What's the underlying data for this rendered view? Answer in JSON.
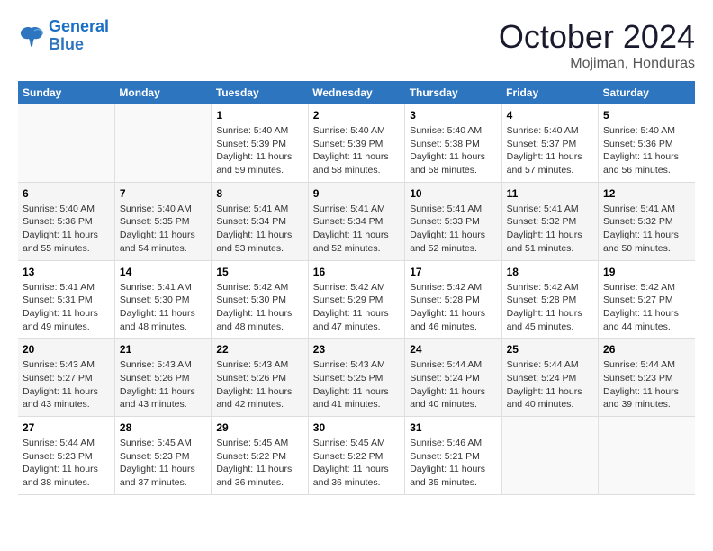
{
  "logo": {
    "line1": "General",
    "line2": "Blue"
  },
  "title": "October 2024",
  "location": "Mojiman, Honduras",
  "weekdays": [
    "Sunday",
    "Monday",
    "Tuesday",
    "Wednesday",
    "Thursday",
    "Friday",
    "Saturday"
  ],
  "weeks": [
    [
      null,
      null,
      {
        "day": "1",
        "sunrise": "5:40 AM",
        "sunset": "5:39 PM",
        "daylight": "11 hours and 59 minutes."
      },
      {
        "day": "2",
        "sunrise": "5:40 AM",
        "sunset": "5:39 PM",
        "daylight": "11 hours and 58 minutes."
      },
      {
        "day": "3",
        "sunrise": "5:40 AM",
        "sunset": "5:38 PM",
        "daylight": "11 hours and 58 minutes."
      },
      {
        "day": "4",
        "sunrise": "5:40 AM",
        "sunset": "5:37 PM",
        "daylight": "11 hours and 57 minutes."
      },
      {
        "day": "5",
        "sunrise": "5:40 AM",
        "sunset": "5:36 PM",
        "daylight": "11 hours and 56 minutes."
      }
    ],
    [
      {
        "day": "6",
        "sunrise": "5:40 AM",
        "sunset": "5:36 PM",
        "daylight": "11 hours and 55 minutes."
      },
      {
        "day": "7",
        "sunrise": "5:40 AM",
        "sunset": "5:35 PM",
        "daylight": "11 hours and 54 minutes."
      },
      {
        "day": "8",
        "sunrise": "5:41 AM",
        "sunset": "5:34 PM",
        "daylight": "11 hours and 53 minutes."
      },
      {
        "day": "9",
        "sunrise": "5:41 AM",
        "sunset": "5:34 PM",
        "daylight": "11 hours and 52 minutes."
      },
      {
        "day": "10",
        "sunrise": "5:41 AM",
        "sunset": "5:33 PM",
        "daylight": "11 hours and 52 minutes."
      },
      {
        "day": "11",
        "sunrise": "5:41 AM",
        "sunset": "5:32 PM",
        "daylight": "11 hours and 51 minutes."
      },
      {
        "day": "12",
        "sunrise": "5:41 AM",
        "sunset": "5:32 PM",
        "daylight": "11 hours and 50 minutes."
      }
    ],
    [
      {
        "day": "13",
        "sunrise": "5:41 AM",
        "sunset": "5:31 PM",
        "daylight": "11 hours and 49 minutes."
      },
      {
        "day": "14",
        "sunrise": "5:41 AM",
        "sunset": "5:30 PM",
        "daylight": "11 hours and 48 minutes."
      },
      {
        "day": "15",
        "sunrise": "5:42 AM",
        "sunset": "5:30 PM",
        "daylight": "11 hours and 48 minutes."
      },
      {
        "day": "16",
        "sunrise": "5:42 AM",
        "sunset": "5:29 PM",
        "daylight": "11 hours and 47 minutes."
      },
      {
        "day": "17",
        "sunrise": "5:42 AM",
        "sunset": "5:28 PM",
        "daylight": "11 hours and 46 minutes."
      },
      {
        "day": "18",
        "sunrise": "5:42 AM",
        "sunset": "5:28 PM",
        "daylight": "11 hours and 45 minutes."
      },
      {
        "day": "19",
        "sunrise": "5:42 AM",
        "sunset": "5:27 PM",
        "daylight": "11 hours and 44 minutes."
      }
    ],
    [
      {
        "day": "20",
        "sunrise": "5:43 AM",
        "sunset": "5:27 PM",
        "daylight": "11 hours and 43 minutes."
      },
      {
        "day": "21",
        "sunrise": "5:43 AM",
        "sunset": "5:26 PM",
        "daylight": "11 hours and 43 minutes."
      },
      {
        "day": "22",
        "sunrise": "5:43 AM",
        "sunset": "5:26 PM",
        "daylight": "11 hours and 42 minutes."
      },
      {
        "day": "23",
        "sunrise": "5:43 AM",
        "sunset": "5:25 PM",
        "daylight": "11 hours and 41 minutes."
      },
      {
        "day": "24",
        "sunrise": "5:44 AM",
        "sunset": "5:24 PM",
        "daylight": "11 hours and 40 minutes."
      },
      {
        "day": "25",
        "sunrise": "5:44 AM",
        "sunset": "5:24 PM",
        "daylight": "11 hours and 40 minutes."
      },
      {
        "day": "26",
        "sunrise": "5:44 AM",
        "sunset": "5:23 PM",
        "daylight": "11 hours and 39 minutes."
      }
    ],
    [
      {
        "day": "27",
        "sunrise": "5:44 AM",
        "sunset": "5:23 PM",
        "daylight": "11 hours and 38 minutes."
      },
      {
        "day": "28",
        "sunrise": "5:45 AM",
        "sunset": "5:23 PM",
        "daylight": "11 hours and 37 minutes."
      },
      {
        "day": "29",
        "sunrise": "5:45 AM",
        "sunset": "5:22 PM",
        "daylight": "11 hours and 36 minutes."
      },
      {
        "day": "30",
        "sunrise": "5:45 AM",
        "sunset": "5:22 PM",
        "daylight": "11 hours and 36 minutes."
      },
      {
        "day": "31",
        "sunrise": "5:46 AM",
        "sunset": "5:21 PM",
        "daylight": "11 hours and 35 minutes."
      },
      null,
      null
    ]
  ]
}
